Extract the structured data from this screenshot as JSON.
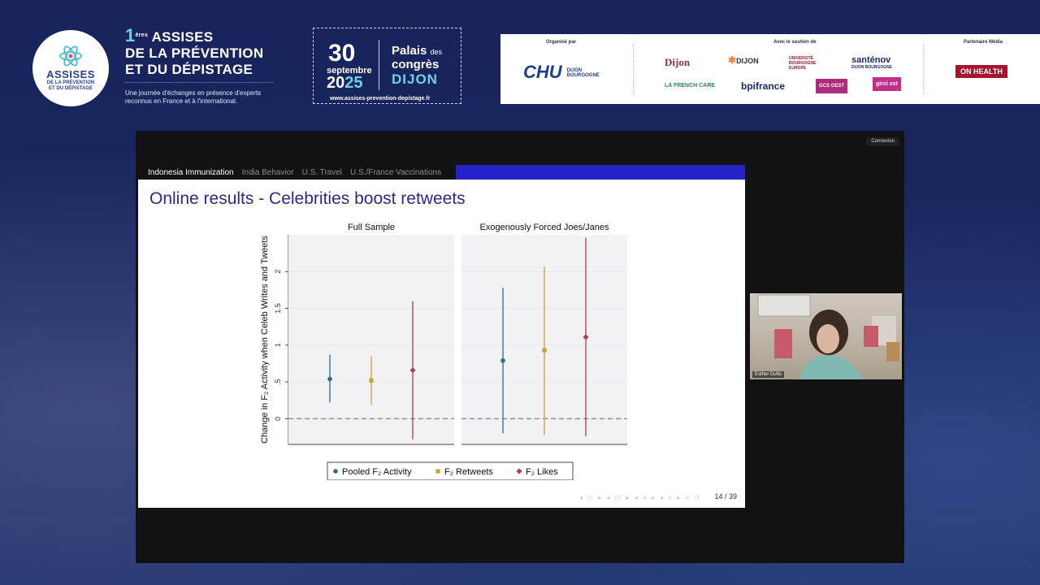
{
  "header": {
    "logo_line1": "ASSISES",
    "logo_line2": "DE LA PRÉVENTION",
    "logo_line3": "ET DU DÉPISTAGE",
    "title_num": "1",
    "title_sup": "ères",
    "title_line1": "ASSISES",
    "title_line2": "DE LA PRÉVENTION",
    "title_line3": "ET DU DÉPISTAGE",
    "subtitle_line1": "Une journée d'échanges en présence d'experts",
    "subtitle_line2": "reconnus en France et à l'international.",
    "date_day": "30",
    "date_month": "septembre",
    "date_year_a": "20",
    "date_year_b": "25",
    "venue_a": "Palais",
    "venue_des": "des",
    "venue_b": "congrès",
    "venue_city": "DIJON",
    "url": "www.assises-prevention-depistage.fr"
  },
  "sponsors": {
    "organized_by": "Organisé par",
    "support_of": "Avec le soutien de",
    "media_partner": "Partenaire Média",
    "chu": "CHU",
    "chu_sub1": "DIJON",
    "chu_sub2": "BOURGOGNE",
    "dijon": "Dijon",
    "dijon_metro": "DIJON",
    "ub": "UNIVERSITÉ BOURGOGNE EUROPE",
    "santenov": "santénov",
    "santenov_sub": "DIJON BOURGOGNE",
    "frenchcare": "LA FRENCH CARE",
    "bpi": "bpifrance",
    "gcs": "GCS  GEST",
    "girc": "girci est",
    "onhealth": "ON HEALTH"
  },
  "window": {
    "connexion": "Connexion"
  },
  "slide": {
    "tabs": [
      "Indonesia Immunization",
      "India Behavior",
      "U.S. Travel",
      "U.S./France Vaccinations"
    ],
    "title": "Online results - Celebrities boost retweets",
    "page": "14 / 39",
    "beamer_nav": "◂ ◻ ▸ ◂ ◰ ▸ ◂ ≡ ▸ ◂ ≡ ▸ ≡ ↺"
  },
  "chart_data": {
    "type": "scatter",
    "subtype": "coefficient-plot",
    "ylabel": "Change in F₂ Activity when Celeb Writes and Tweets",
    "panels": [
      {
        "title": "Full Sample",
        "points": [
          {
            "series": "Pooled F₂ Activity",
            "estimate": 0.54,
            "ci": [
              0.22,
              0.87
            ]
          },
          {
            "series": "F₂ Retweets",
            "estimate": 0.52,
            "ci": [
              0.19,
              0.85
            ]
          },
          {
            "series": "F₂ Likes",
            "estimate": 0.66,
            "ci": [
              -0.28,
              1.6
            ]
          }
        ]
      },
      {
        "title": "Exogenously Forced Joes/Janes",
        "points": [
          {
            "series": "Pooled F₂ Activity",
            "estimate": 0.79,
            "ci": [
              -0.2,
              1.78
            ]
          },
          {
            "series": "F₂ Retweets",
            "estimate": 0.93,
            "ci": [
              -0.22,
              2.07
            ]
          },
          {
            "series": "F₂ Likes",
            "estimate": 1.11,
            "ci": [
              -0.24,
              2.46
            ]
          }
        ]
      }
    ],
    "series": [
      {
        "name": "Pooled F₂ Activity",
        "color": "#2e6a8e",
        "marker": "circle"
      },
      {
        "name": "F₂ Retweets",
        "color": "#c8a035",
        "marker": "square"
      },
      {
        "name": "F₂ Likes",
        "color": "#b23a48",
        "marker": "diamond"
      }
    ],
    "yticks": [
      "0",
      ".5",
      "1",
      "1.5",
      "2"
    ],
    "ylim": [
      -0.35,
      2.5
    ],
    "reference_line": 0,
    "legend_position": "bottom"
  },
  "camera": {
    "name": "Esther Duflo"
  }
}
